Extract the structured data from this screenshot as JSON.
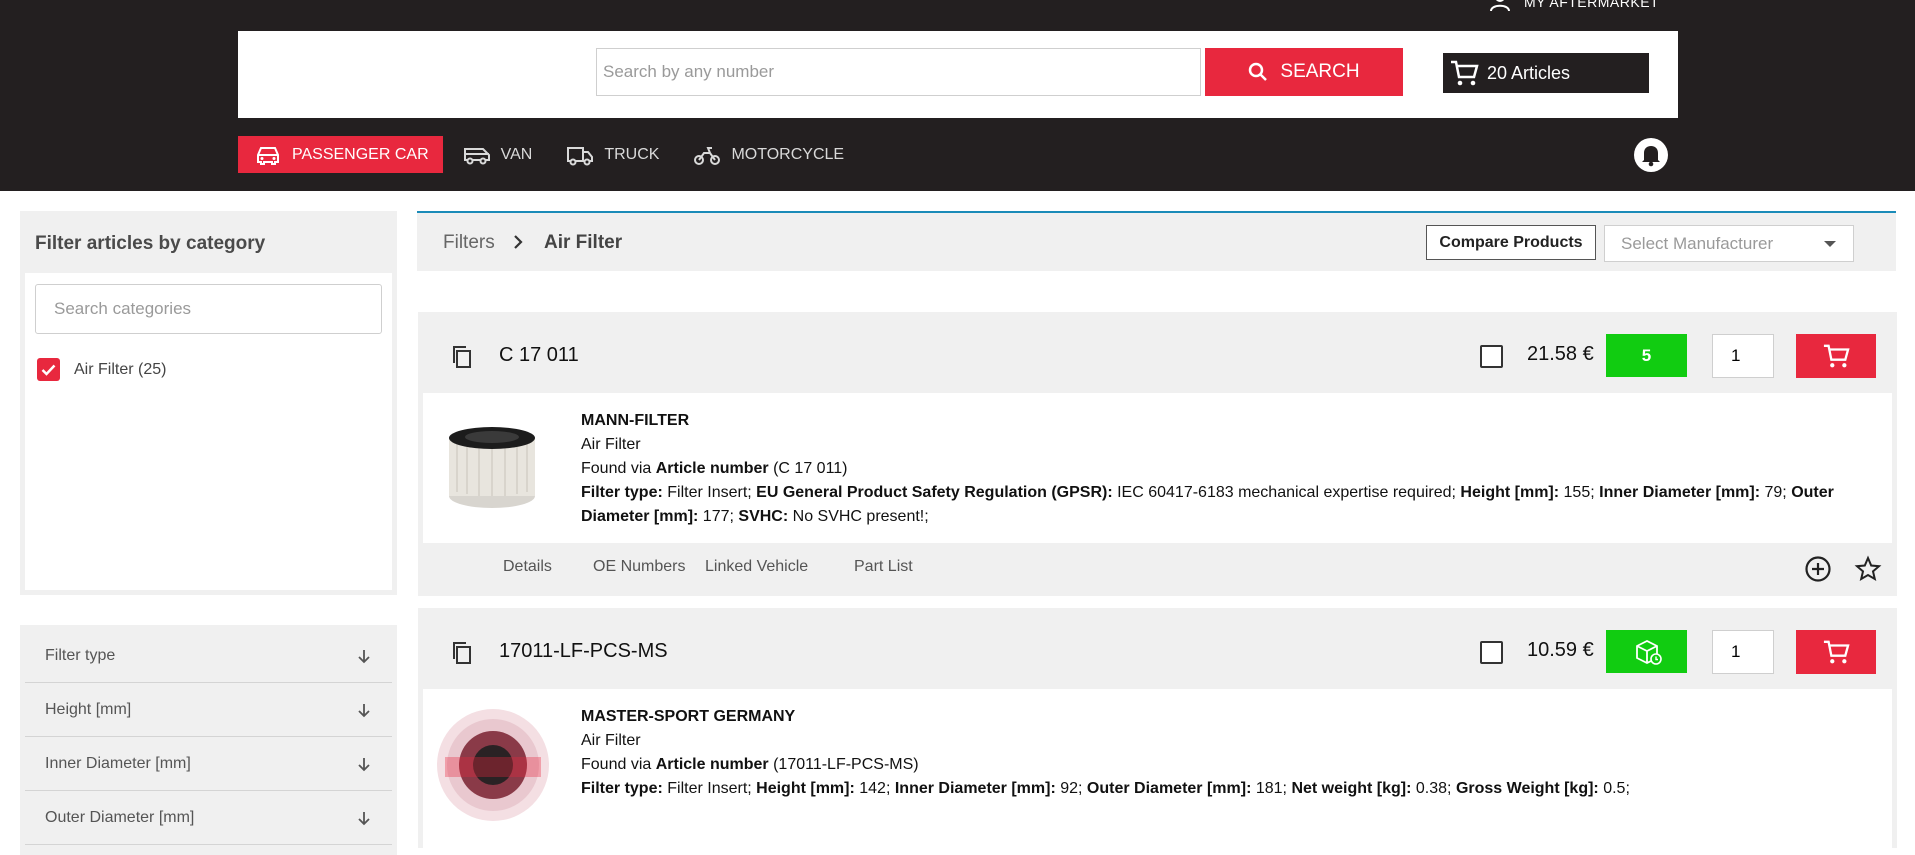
{
  "header": {
    "my_aftermarket": "MY AFTERMARKET",
    "search_placeholder": "Search by any number",
    "search_label": "SEARCH",
    "cart_label": "20 Articles",
    "vehicle_tabs": [
      {
        "label": "PASSENGER CAR",
        "icon": "car-icon",
        "active": true
      },
      {
        "label": "VAN",
        "icon": "van-icon",
        "active": false
      },
      {
        "label": "TRUCK",
        "icon": "truck-icon",
        "active": false
      },
      {
        "label": "MOTORCYCLE",
        "icon": "motorcycle-icon",
        "active": false
      }
    ]
  },
  "sidebar": {
    "category_title": "Filter articles by category",
    "category_search_placeholder": "Search categories",
    "category_item": "Air Filter (25)",
    "attributes": [
      "Filter type",
      "Height [mm]",
      "Inner Diameter [mm]",
      "Outer Diameter [mm]"
    ]
  },
  "breadcrumb": {
    "parent": "Filters",
    "current": "Air Filter",
    "compare_label": "Compare Products",
    "manufacturer_placeholder": "Select Manufacturer"
  },
  "articles": [
    {
      "number": "C 17 011",
      "price": "21.58 €",
      "stock": "5",
      "qty": "1",
      "brand": "MANN-FILTER",
      "category": "Air Filter",
      "found_via_prefix": "Found via",
      "found_via_label": "Article number",
      "found_via_value": "(C 17 011)",
      "specs": [
        {
          "k": "Filter type:",
          "v": " Filter Insert;"
        },
        {
          "k": "EU General Product Safety Regulation (GPSR):",
          "v": " IEC 60417-6183 mechanical expertise required;"
        },
        {
          "k": "Height [mm]:",
          "v": " 155;"
        },
        {
          "k": "Inner Diameter [mm]:",
          "v": " 79;"
        },
        {
          "k": "Outer Diameter [mm]:",
          "v": " 177;"
        },
        {
          "k": "SVHC:",
          "v": " No SVHC present!;"
        }
      ],
      "tabs": [
        "Details",
        "OE Numbers",
        "Linked Vehicle",
        "Part List"
      ]
    },
    {
      "number": "17011-LF-PCS-MS",
      "price": "10.59 €",
      "stock_icon": "warehouse-box-icon",
      "qty": "1",
      "brand": "MASTER-SPORT GERMANY",
      "category": "Air Filter",
      "found_via_prefix": "Found via",
      "found_via_label": "Article number",
      "found_via_value": "(17011-LF-PCS-MS)",
      "specs": [
        {
          "k": "Filter type:",
          "v": " Filter Insert;"
        },
        {
          "k": "Height [mm]:",
          "v": " 142;"
        },
        {
          "k": "Inner Diameter [mm]:",
          "v": " 92;"
        },
        {
          "k": "Outer Diameter [mm]:",
          "v": " 181;"
        },
        {
          "k": "Net weight [kg]:",
          "v": " 0.38;"
        },
        {
          "k": "Gross Weight [kg]:",
          "v": " 0.5;"
        }
      ]
    }
  ],
  "colors": {
    "brand_red": "#e8283e",
    "header_dark": "#231f20",
    "stock_green": "#11cc11",
    "accent_blue": "#1a8bb8"
  }
}
